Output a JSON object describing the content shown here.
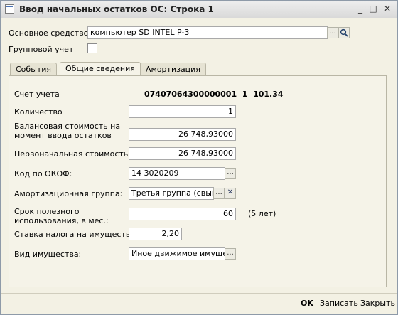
{
  "window": {
    "title": "Ввод начальных остатков ОС: Строка 1",
    "min_glyph": "_",
    "max_glyph": "□",
    "close_glyph": "✕"
  },
  "header": {
    "asset_label": "Основное средство",
    "asset_value": "компьютер SD INTEL P-3",
    "group_label": "Групповой учет",
    "group_checked": false
  },
  "tabs": [
    {
      "label": "События",
      "active": false
    },
    {
      "label": "Общие сведения",
      "active": true
    },
    {
      "label": "Амортизация",
      "active": false
    }
  ],
  "form": {
    "account_label": "Счет учета",
    "account_value": "07407064300000001  1  101.34",
    "qty_label": "Количество",
    "qty_value": "1",
    "balance_label_1": "Балансовая стоимость на",
    "balance_label_2": "момент ввода остатков",
    "balance_value": "26 748,93000",
    "initial_label": "Первоначальная стоимость",
    "initial_value": "26 748,93000",
    "okof_label": "Код по ОКОФ:",
    "okof_value": "14 3020209",
    "amort_label": "Амортизационная группа:",
    "amort_value": "Третья группа (свыше",
    "life_label_1": "Срок полезного",
    "life_label_2": "использования, в мес.:",
    "life_value": "60",
    "life_note": "(5 лет)",
    "tax_label": "Ставка налога на имущество",
    "tax_value": "2,20",
    "kind_label": "Вид имущества:",
    "kind_value": "Иное движимое имущест"
  },
  "footer": {
    "ok": "OK",
    "save": "Записать",
    "close": "Закрыть"
  },
  "icons": {
    "ellipsis": "...",
    "clear": "✕",
    "search": "search-icon"
  },
  "colors": {
    "window_bg": "#f3f1e4",
    "panel_bg": "#f5f3e8",
    "clear_icon": "#1f2f5a"
  }
}
